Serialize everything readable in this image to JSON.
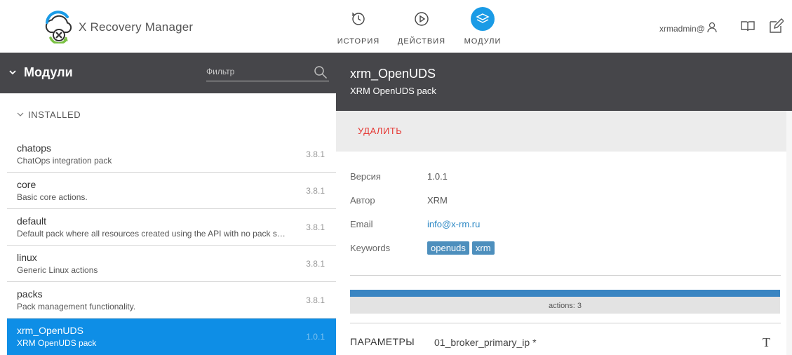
{
  "app": {
    "brand": "X Recovery Manager"
  },
  "nav": {
    "items": [
      {
        "label": "ИСТОРИЯ",
        "icon": "history-icon"
      },
      {
        "label": "ДЕЙСТВИЯ",
        "icon": "play-icon"
      },
      {
        "label": "МОДУЛИ",
        "icon": "layers-icon",
        "active": true
      }
    ]
  },
  "user": {
    "name": "xrmadmin@"
  },
  "left": {
    "title": "Модули",
    "filter_placeholder": "Фильтр",
    "group": "INSTALLED",
    "packs": [
      {
        "name": "chatops",
        "desc": "ChatOps integration pack",
        "version": "3.8.1"
      },
      {
        "name": "core",
        "desc": "Basic core actions.",
        "version": "3.8.1"
      },
      {
        "name": "default",
        "desc": "Default pack where all resources created using the API with no pack specified get saved.",
        "version": "3.8.1"
      },
      {
        "name": "linux",
        "desc": "Generic Linux actions",
        "version": "3.8.1"
      },
      {
        "name": "packs",
        "desc": "Pack management functionality.",
        "version": "3.8.1"
      },
      {
        "name": "xrm_OpenUDS",
        "desc": "XRM OpenUDS pack",
        "version": "1.0.1",
        "selected": true
      }
    ]
  },
  "detail": {
    "title": "xrm_OpenUDS",
    "subtitle": "XRM OpenUDS pack",
    "delete_label": "УДАЛИТЬ",
    "version_label": "Версия",
    "version": "1.0.1",
    "author_label": "Автор",
    "author": "XRM",
    "email_label": "Email",
    "email": "info@x-rm.ru",
    "keywords_label": "Keywords",
    "keywords": [
      "openuds",
      "xrm"
    ],
    "actions_bar": {
      "label": "actions: 3",
      "fraction": 1.0
    },
    "params_label": "ПАРАМЕТРЫ",
    "param_name": "01_broker_primary_ip *",
    "param_type_icon": "T"
  },
  "colors": {
    "accent": "#1a9be6",
    "header_dark": "#46464a",
    "selected_row": "#0e8ee6",
    "danger": "#e53935",
    "tag": "#4d8fbd"
  }
}
